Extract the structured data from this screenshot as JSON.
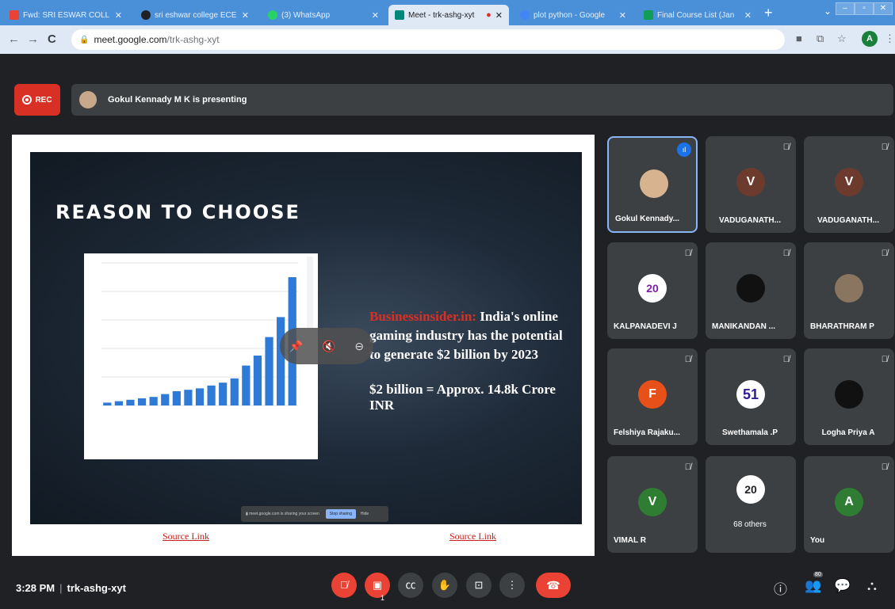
{
  "browser": {
    "tabs": [
      {
        "label": "Fwd: SRI ESWAR COLL",
        "color": "#ea4335"
      },
      {
        "label": "sri eshwar college ECE",
        "color": "#202124"
      },
      {
        "label": "(3) WhatsApp",
        "color": "#25d366"
      },
      {
        "label": "Meet - trk-ashg-xyt",
        "color": "#00897b"
      },
      {
        "label": "plot python - Google",
        "color": "#4285f4"
      },
      {
        "label": "Final Course List (Jan",
        "color": "#0f9d58"
      }
    ],
    "new_tab": "+",
    "url_main": "meet.google.com",
    "url_path": "/trk-ashg-xyt",
    "profile_initial": "A"
  },
  "meet": {
    "rec_label": "REC",
    "presenting": "Gokul Kennady M K is presenting",
    "slide": {
      "title": "REASON TO CHOOSE",
      "source_name": "Businessinsider.in:",
      "text": "India's online gaming industry has the potential to generate $2 billion by 2023",
      "text2": "$2 billion = Approx. 14.8k Crore INR",
      "source_links": [
        "Source Link",
        "Source Link"
      ]
    },
    "participants": [
      {
        "name": "Gokul Kennady...",
        "initial": "",
        "color": "#d7b48f",
        "speaking": true
      },
      {
        "name": "VADUGANATH...",
        "initial": "V",
        "color": "#6d3b2d"
      },
      {
        "name": "VADUGANATH...",
        "initial": "V",
        "color": "#6d3b2d"
      },
      {
        "name": "KALPANADEVI J",
        "initial": "20",
        "color": "#ffffff"
      },
      {
        "name": "MANIKANDAN ...",
        "initial": "",
        "color": "#111111"
      },
      {
        "name": "BHARATHRAM P",
        "initial": "",
        "color": "#8a7560"
      },
      {
        "name": "Felshiya Rajaku...",
        "initial": "F",
        "color": "#e8501a"
      },
      {
        "name": "Swethamala .P",
        "initial": "51",
        "color": "#ffffff"
      },
      {
        "name": "Logha Priya A",
        "initial": "",
        "color": "#111111"
      },
      {
        "name": "VIMAL R",
        "initial": "V",
        "color": "#2e7d32"
      },
      {
        "name": "68 others",
        "initial": "20",
        "color": "#ffffff"
      },
      {
        "name": "You",
        "initial": "A",
        "color": "#2e7d32"
      }
    ],
    "time": "3:28 PM",
    "code": "trk-ashg-xyt",
    "people_count": "80",
    "present_badge": "1"
  },
  "chart_data": {
    "type": "bar",
    "values": [
      2,
      3,
      4,
      5,
      6,
      8,
      10,
      11,
      12,
      14,
      16,
      19,
      28,
      35,
      48,
      62,
      90
    ],
    "ylim": [
      0,
      100
    ]
  }
}
